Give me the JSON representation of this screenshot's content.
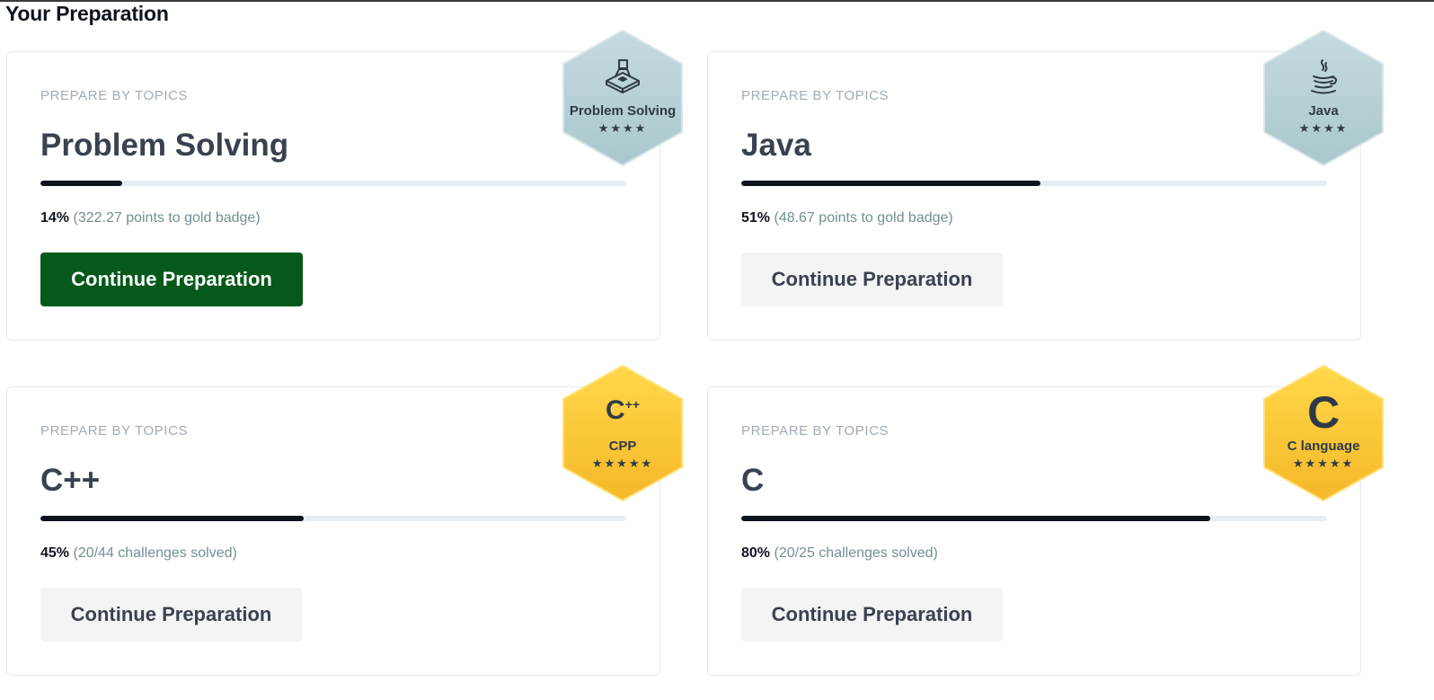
{
  "page": {
    "title": "Your Preparation"
  },
  "cards": [
    {
      "eyebrow": "PREPARE BY TOPICS",
      "title": "Problem Solving",
      "progress_percent": 14,
      "progress_pct_label": "14%",
      "progress_detail": "(322.27 points to gold badge)",
      "button_label": "Continue Preparation",
      "button_style": "primary",
      "badge": {
        "label": "Problem Solving",
        "stars": "★★★★",
        "icon": "problem-solving-icon",
        "tier": "silver"
      }
    },
    {
      "eyebrow": "PREPARE BY TOPICS",
      "title": "Java",
      "progress_percent": 51,
      "progress_pct_label": "51%",
      "progress_detail": "(48.67 points to gold badge)",
      "button_label": "Continue Preparation",
      "button_style": "secondary",
      "badge": {
        "label": "Java",
        "stars": "★★★★",
        "icon": "java-icon",
        "tier": "silver"
      }
    },
    {
      "eyebrow": "PREPARE BY TOPICS",
      "title": "C++",
      "progress_percent": 45,
      "progress_pct_label": "45%",
      "progress_detail": "(20/44 challenges solved)",
      "button_label": "Continue Preparation",
      "button_style": "secondary",
      "badge": {
        "label": "CPP",
        "stars": "★★★★★",
        "icon": "cpp-icon",
        "glyph": "C",
        "glyph_sup": "++",
        "tier": "gold"
      }
    },
    {
      "eyebrow": "PREPARE BY TOPICS",
      "title": "C",
      "progress_percent": 80,
      "progress_pct_label": "80%",
      "progress_detail": "(20/25 challenges solved)",
      "button_label": "Continue Preparation",
      "button_style": "secondary",
      "badge": {
        "label": "C language",
        "stars": "★★★★★",
        "icon": "c-language-icon",
        "glyph": "C",
        "tier": "gold"
      }
    }
  ],
  "colors": {
    "primary_button": "#05591b",
    "secondary_button": "#f3f4f6",
    "progress_fill": "#0e141e",
    "progress_track": "#e7eef3",
    "silver_badge_top": "#c5dbe0",
    "silver_badge_bottom": "#a9c8cc",
    "gold_badge_top": "#ffd84a",
    "gold_badge_bottom": "#f5b829"
  }
}
